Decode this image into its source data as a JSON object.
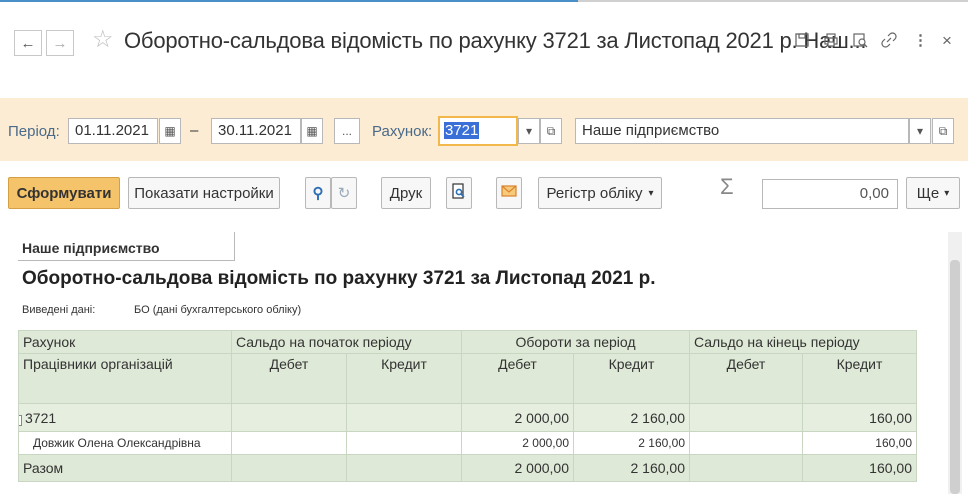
{
  "window": {
    "title": "Оборотно-сальдова відомість по рахунку 3721 за Листопад 2021 р. Наш...",
    "close": "×",
    "more": "⋮"
  },
  "filters": {
    "period_label": "Період:",
    "date_from": "01.11.2021",
    "dash": "–",
    "date_to": "30.11.2021",
    "ellipsis": "...",
    "account_label": "Рахунок:",
    "account": "3721",
    "organization": "Наше підприємство"
  },
  "toolbar": {
    "generate": "Сформувати",
    "show_settings": "Показати настройки",
    "print": "Друк",
    "register": "Регістр обліку",
    "sigma": "Σ",
    "sum_value": "0,00",
    "more": "Ще"
  },
  "report": {
    "organization": "Наше підприємство",
    "title": "Оборотно-сальдова відомість по рахунку 3721 за Листопад 2021 р.",
    "shown_data_label": "Виведені дані:",
    "shown_data_value": "БО (дані бухгалтерського обліку)",
    "headers": {
      "account": "Рахунок",
      "opening": "Сальдо на початок періоду",
      "turnover": "Обороти за період",
      "closing": "Сальдо на кінець періоду",
      "subconto": "Працівники організацій",
      "debit": "Дебет",
      "credit": "Кредит"
    },
    "group_row": {
      "toggle": "−",
      "name": "3721",
      "turnover_debit": "2 000,00",
      "turnover_credit": "2 160,00",
      "closing_credit": "160,00"
    },
    "detail_row": {
      "name": "Довжик Олена Олександрівна",
      "turnover_debit": "2 000,00",
      "turnover_credit": "2 160,00",
      "closing_credit": "160,00"
    },
    "total_row": {
      "name": "Разом",
      "turnover_debit": "2 000,00",
      "turnover_credit": "2 160,00",
      "closing_credit": "160,00"
    }
  }
}
